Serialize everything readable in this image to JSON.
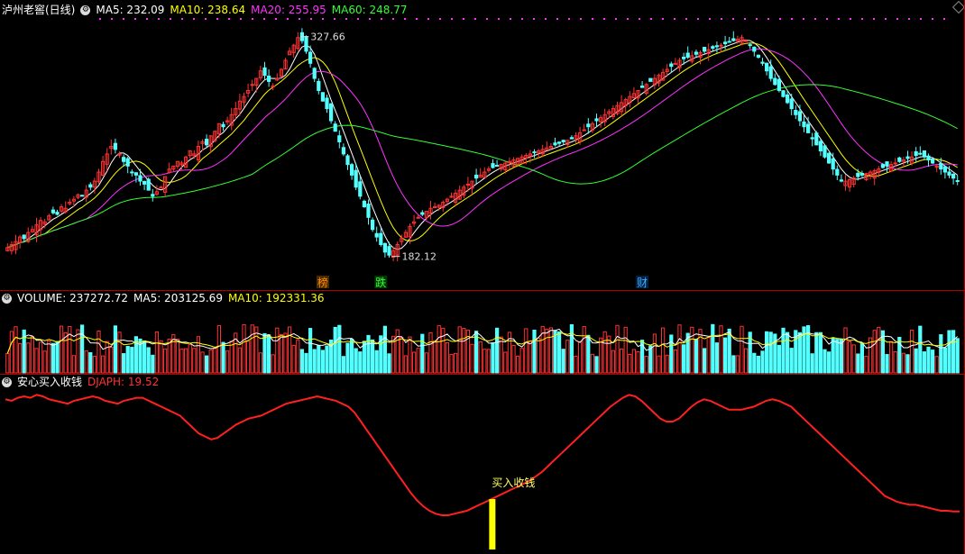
{
  "main_panel": {
    "stock_name": "泸州老窖(日线)",
    "indicators": [
      {
        "label": "MA5: 232.09",
        "color": "#ffffff"
      },
      {
        "label": "MA10: 238.64",
        "color": "#ffff00"
      },
      {
        "label": "MA20: 255.95",
        "color": "#ff33ff"
      },
      {
        "label": "MA60: 248.77",
        "color": "#33ff33"
      }
    ],
    "high_label": "327.66",
    "low_label": "182.12",
    "markers": [
      {
        "text": "榜",
        "color": "#ff8c00",
        "bg": "#4a2a00",
        "at": 76
      },
      {
        "text": "跌",
        "color": "#33ff33",
        "bg": "#003a00",
        "at": 90
      },
      {
        "text": "财",
        "color": "#44aaff",
        "bg": "#002244",
        "at": 153
      }
    ]
  },
  "volume_panel": {
    "label": "VOLUME: 237272.72",
    "ma5": "MA5: 203125.69",
    "ma10": "MA10: 192331.36"
  },
  "indicator_panel": {
    "name": "安心买入收钱",
    "value": "DJAPH: 19.52",
    "signal_label": "买入收钱"
  },
  "colors": {
    "up": "#ff3232",
    "down": "#54ffff",
    "bg": "#000000",
    "grid": "#b00000"
  },
  "chart_data": {
    "type": "candlestick",
    "price_ylim": [
      170,
      340
    ],
    "high": {
      "value": 327.66,
      "index": 70
    },
    "low": {
      "value": 182.12,
      "index": 92
    },
    "closes": [
      188,
      190,
      192,
      195,
      194,
      198,
      200,
      203,
      206,
      205,
      209,
      211,
      210,
      215,
      214,
      218,
      220,
      223,
      222,
      226,
      228,
      232,
      238,
      245,
      250,
      255,
      253,
      250,
      245,
      242,
      238,
      236,
      232,
      230,
      226,
      222,
      225,
      228,
      235,
      240,
      242,
      245,
      244,
      248,
      252,
      250,
      255,
      258,
      256,
      262,
      265,
      270,
      268,
      272,
      276,
      280,
      285,
      288,
      292,
      296,
      300,
      305,
      302,
      298,
      295,
      300,
      306,
      312,
      318,
      322,
      327,
      325,
      318,
      310,
      300,
      292,
      285,
      280,
      272,
      265,
      258,
      250,
      243,
      236,
      228,
      222,
      215,
      208,
      200,
      195,
      190,
      185,
      183,
      186,
      190,
      194,
      198,
      202,
      205,
      208,
      210,
      212,
      214,
      215,
      216,
      218,
      220,
      222,
      224,
      226,
      228,
      230,
      232,
      234,
      236,
      238,
      240,
      241,
      242,
      243,
      244,
      245,
      246,
      247,
      248,
      249,
      250,
      251,
      252,
      253,
      254,
      255,
      256,
      257,
      258,
      259,
      260,
      262,
      264,
      266,
      268,
      270,
      272,
      274,
      276,
      278,
      280,
      282,
      284,
      286,
      288,
      290,
      292,
      294,
      296,
      298,
      300,
      302,
      304,
      306,
      308,
      310,
      312,
      313,
      314,
      315,
      316,
      317,
      318,
      319,
      320,
      321,
      322,
      323,
      324,
      325,
      326,
      327,
      325,
      322,
      318,
      314,
      310,
      305,
      300,
      296,
      292,
      288,
      284,
      280,
      276,
      272,
      268,
      264,
      260,
      256,
      252,
      248,
      244,
      240,
      236,
      232,
      232,
      233,
      234,
      235,
      236,
      237,
      238,
      239,
      240,
      241,
      242,
      243,
      244,
      245,
      246,
      247,
      248,
      249,
      250,
      248,
      246,
      244,
      242,
      240,
      238,
      236,
      234,
      232
    ],
    "volume_ylim": [
      0,
      400000
    ],
    "indicator_ylim": [
      0,
      100
    ],
    "djaph": [
      95,
      94,
      96,
      97,
      96,
      98,
      97,
      95,
      94,
      93,
      92,
      94,
      95,
      96,
      97,
      96,
      94,
      93,
      92,
      94,
      95,
      96,
      96,
      94,
      92,
      90,
      88,
      86,
      84,
      80,
      76,
      72,
      70,
      68,
      69,
      72,
      75,
      78,
      80,
      82,
      83,
      84,
      86,
      88,
      90,
      92,
      93,
      94,
      95,
      96,
      97,
      96,
      95,
      94,
      92,
      90,
      86,
      80,
      74,
      68,
      62,
      56,
      50,
      44,
      38,
      32,
      27,
      23,
      20,
      18,
      17,
      17,
      18,
      19,
      20,
      22,
      24,
      26,
      28,
      30,
      32,
      34,
      36,
      38,
      40,
      43,
      46,
      50,
      54,
      58,
      62,
      66,
      70,
      74,
      78,
      82,
      86,
      90,
      93,
      96,
      98,
      97,
      94,
      90,
      86,
      82,
      80,
      80,
      82,
      86,
      90,
      93,
      95,
      94,
      92,
      90,
      88,
      88,
      88,
      89,
      90,
      92,
      94,
      95,
      94,
      92,
      90,
      86,
      82,
      78,
      74,
      70,
      66,
      62,
      58,
      54,
      50,
      46,
      42,
      38,
      34,
      30,
      28,
      26,
      25,
      24,
      24,
      23,
      22,
      21,
      20,
      20,
      19.5,
      19.52
    ],
    "buy_signal_index": 78
  }
}
